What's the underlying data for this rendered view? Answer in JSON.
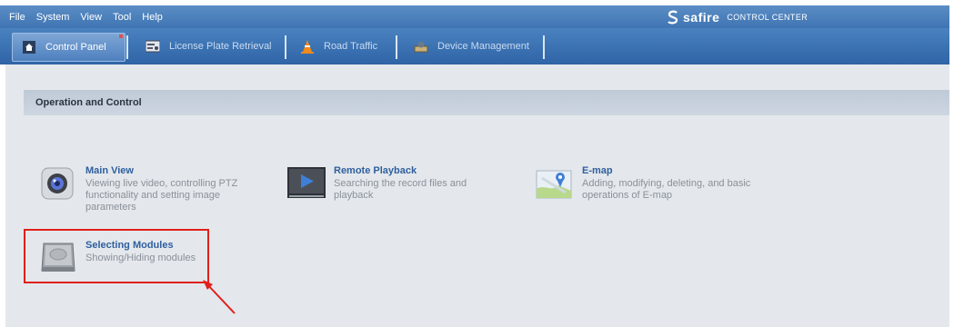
{
  "menu": {
    "items": [
      "File",
      "System",
      "View",
      "Tool",
      "Help"
    ]
  },
  "brand": {
    "name": "safire",
    "subtitle": "CONTROL CENTER"
  },
  "tabs": [
    {
      "label": "Control Panel",
      "icon": "home-icon",
      "active": true
    },
    {
      "label": "License Plate Retrieval",
      "icon": "card-icon",
      "active": false
    },
    {
      "label": "Road Traffic",
      "icon": "traffic-cone-icon",
      "active": false
    },
    {
      "label": "Device Management",
      "icon": "device-icon",
      "active": false
    }
  ],
  "section": {
    "title": "Operation and Control"
  },
  "modules": [
    {
      "title": "Main View",
      "desc": [
        "Viewing live video, controlling PTZ",
        "functionality and setting image",
        "parameters"
      ],
      "icon": "camera-lens-icon"
    },
    {
      "title": "Remote Playback",
      "desc": [
        "Searching the record files and",
        "playback"
      ],
      "icon": "playback-icon"
    },
    {
      "title": "E-map",
      "desc": [
        "Adding, modifying, deleting, and basic",
        "operations of E-map"
      ],
      "icon": "map-icon"
    },
    {
      "title": "Selecting Modules",
      "desc": [
        "Showing/Hiding modules"
      ],
      "icon": "hard-drive-icon"
    }
  ],
  "colors": {
    "menubar": "#4a7fbd",
    "tabbar": "#3a6fb0",
    "content": "#e4e8ec",
    "highlight": "#e0201c"
  }
}
